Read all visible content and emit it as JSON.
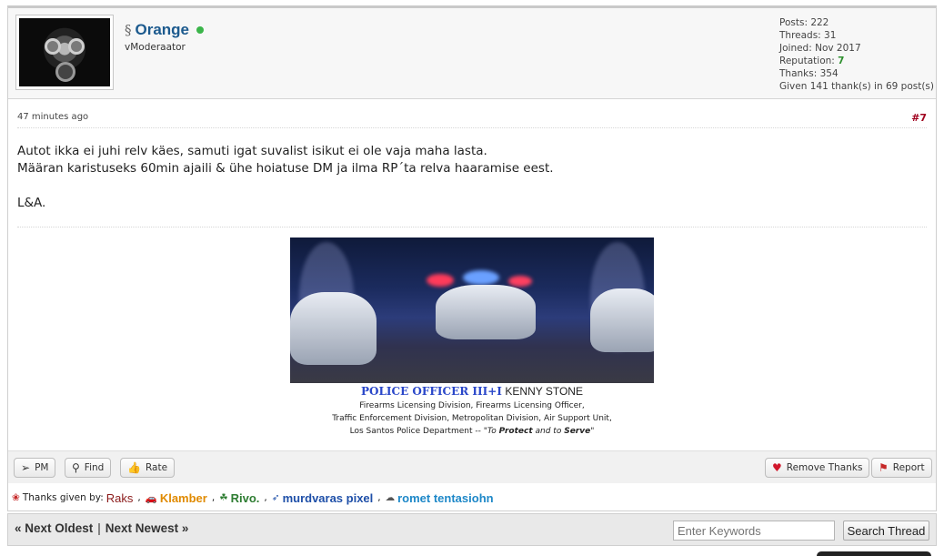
{
  "author": {
    "username": "Orange",
    "usertitle": "vModeraator",
    "stats": {
      "posts": "Posts: 222",
      "threads": "Threads: 31",
      "joined": "Joined: Nov 2017",
      "reputation_label": "Reputation:",
      "reputation_value": "7",
      "thanks": "Thanks: 354",
      "given": "Given 141 thank(s) in 69 post(s)"
    }
  },
  "post": {
    "time": "47 minutes ago",
    "number": "#7",
    "lines": [
      "Autot ikka ei juhi relv käes, samuti igat suvalist isikut ei ole vaja maha lasta.",
      "Määran karistuseks 60min ajaili & ühe hoiatuse DM ja ilma RP´ta relva haaramise eest.",
      "L&A."
    ]
  },
  "signature": {
    "rank": "POLICE OFFICER III+I",
    "name": "KENNY STONE",
    "line1": "Firearms Licensing Division, Firearms Licensing Officer,",
    "line2": "Traffic Enforcement Division, Metropolitan Division, Air Support Unit,",
    "line3_prefix": "Los Santos Police Department --",
    "motto_part1": "\"To",
    "motto_bold1": "Protect",
    "motto_part2": "and to",
    "motto_bold2": "Serve",
    "motto_end": "\""
  },
  "actions": {
    "pm": "PM",
    "find": "Find",
    "rate": "Rate",
    "remove_thanks": "Remove Thanks",
    "report": "Report"
  },
  "thanks": {
    "label": "Thanks given by:",
    "users": [
      {
        "name": "Raks",
        "color": "#8b1a1a"
      },
      {
        "name": "Klamber",
        "color": "#e08a00"
      },
      {
        "name": "Rivo.",
        "color": "#2e7d32"
      },
      {
        "name": "murdvaras pixel",
        "color": "#1e4fa8"
      },
      {
        "name": "romet tentasiohn",
        "color": "#1e88c8"
      }
    ],
    "comma": ","
  },
  "navigation": {
    "next_oldest": "« Next Oldest",
    "separator": "|",
    "next_newest": "Next Newest »",
    "keywords_placeholder": "Enter Keywords",
    "search_button": "Search Thread"
  }
}
